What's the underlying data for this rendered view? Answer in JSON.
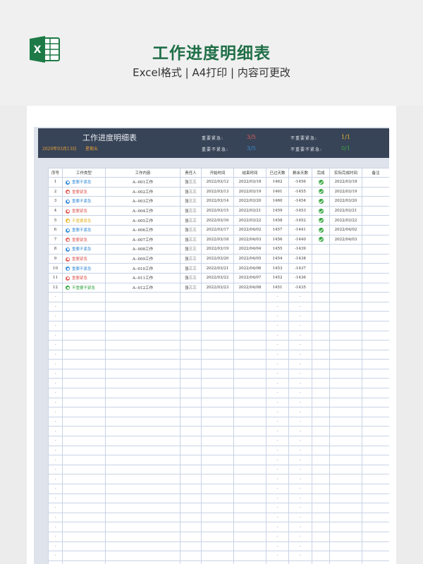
{
  "hero": {
    "title": "工作进度明细表",
    "subtitle": "Excel格式 | A4打印 | 内容可更改",
    "logo_icon": "excel-logo-icon",
    "title_color": "#1f6f47"
  },
  "sheet": {
    "title": "工作进度明细表",
    "date": "2020年03月13日",
    "weekday": "星期五",
    "stats": [
      {
        "label": "重要紧急:",
        "value": "3/5",
        "color": "#e0605a"
      },
      {
        "label": "不重要紧急:",
        "value": "1/1",
        "color": "#e6b72e"
      },
      {
        "label": "重要不紧急:",
        "value": "3/5",
        "color": "#3a8ed8"
      },
      {
        "label": "不重要不紧急:",
        "value": "0/1",
        "color": "#3aa845"
      }
    ],
    "columns": [
      "序号",
      "工作类型",
      "工作内容",
      "责任人",
      "开始时间",
      "结束时间",
      "已过天数",
      "剩余天数",
      "完成",
      "实际完成时间",
      "备注"
    ],
    "type_colors": {
      "重要不紧急": "#3a8ed8",
      "重要紧急": "#e0605a",
      "不重要紧急": "#e6b72e",
      "不重要不紧急": "#3aa845"
    },
    "rows": [
      {
        "no": "1",
        "type": "重要不紧急",
        "content": "A--001工作",
        "owner": "张三三",
        "start": "2022/03/12",
        "end": "2022/03/18",
        "passed": "1462",
        "remain": "-1456",
        "done": true,
        "actual": "2022/03/18",
        "note": ""
      },
      {
        "no": "2",
        "type": "重要紧急",
        "content": "A--002工作",
        "owner": "张三三",
        "start": "2022/03/13",
        "end": "2022/03/19",
        "passed": "1461",
        "remain": "-1455",
        "done": true,
        "actual": "2022/03/19",
        "note": ""
      },
      {
        "no": "3",
        "type": "重要不紧急",
        "content": "A--003工作",
        "owner": "张三三",
        "start": "2022/03/14",
        "end": "2022/03/20",
        "passed": "1460",
        "remain": "-1454",
        "done": true,
        "actual": "2022/03/20",
        "note": ""
      },
      {
        "no": "4",
        "type": "重要紧急",
        "content": "A--004工作",
        "owner": "张三三",
        "start": "2022/03/15",
        "end": "2022/03/21",
        "passed": "1459",
        "remain": "-1453",
        "done": true,
        "actual": "2022/03/21",
        "note": ""
      },
      {
        "no": "5",
        "type": "不重要紧急",
        "content": "A--005工作",
        "owner": "张三三",
        "start": "2022/03/16",
        "end": "2022/03/22",
        "passed": "1458",
        "remain": "-1452",
        "done": true,
        "actual": "2022/03/22",
        "note": ""
      },
      {
        "no": "6",
        "type": "重要不紧急",
        "content": "A--006工作",
        "owner": "张三三",
        "start": "2022/03/17",
        "end": "2022/04/02",
        "passed": "1457",
        "remain": "-1441",
        "done": true,
        "actual": "2022/04/02",
        "note": ""
      },
      {
        "no": "7",
        "type": "重要紧急",
        "content": "A--007工作",
        "owner": "张三三",
        "start": "2022/03/18",
        "end": "2022/04/03",
        "passed": "1456",
        "remain": "-1440",
        "done": true,
        "actual": "2022/04/03",
        "note": ""
      },
      {
        "no": "8",
        "type": "重要不紧急",
        "content": "A--008工作",
        "owner": "张三三",
        "start": "2022/03/19",
        "end": "2022/04/04",
        "passed": "1455",
        "remain": "-1439",
        "done": false,
        "actual": "",
        "note": ""
      },
      {
        "no": "9",
        "type": "重要紧急",
        "content": "A--009工作",
        "owner": "张三三",
        "start": "2022/03/20",
        "end": "2022/04/05",
        "passed": "1454",
        "remain": "-1438",
        "done": false,
        "actual": "",
        "note": ""
      },
      {
        "no": "10",
        "type": "重要不紧急",
        "content": "A--010工作",
        "owner": "张三三",
        "start": "2022/03/21",
        "end": "2022/04/06",
        "passed": "1453",
        "remain": "-1437",
        "done": false,
        "actual": "",
        "note": ""
      },
      {
        "no": "11",
        "type": "重要紧急",
        "content": "A--011工作",
        "owner": "张三三",
        "start": "2022/03/22",
        "end": "2022/04/07",
        "passed": "1452",
        "remain": "-1436",
        "done": false,
        "actual": "",
        "note": ""
      },
      {
        "no": "12",
        "type": "不重要不紧急",
        "content": "A--012工作",
        "owner": "张三三",
        "start": "2022/03/23",
        "end": "2022/04/08",
        "passed": "1451",
        "remain": "-1435",
        "done": false,
        "actual": "",
        "note": ""
      }
    ],
    "empty_placeholder": "-",
    "empty_row_count": 29
  }
}
